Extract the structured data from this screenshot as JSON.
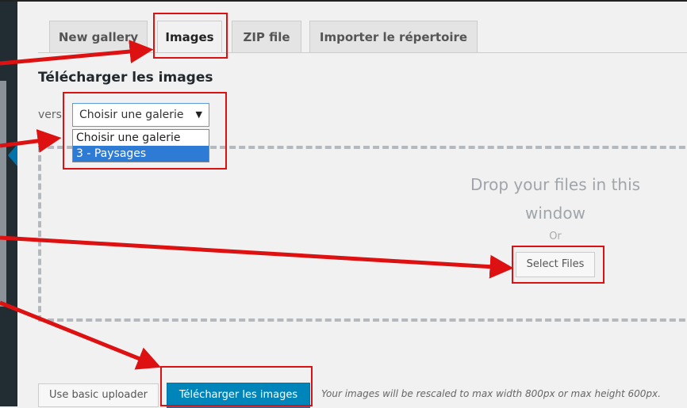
{
  "tabs": [
    {
      "label": "New gallery",
      "active": false
    },
    {
      "label": "Images",
      "active": true
    },
    {
      "label": "ZIP file",
      "active": false
    },
    {
      "label": "Importer le répertoire",
      "active": false
    }
  ],
  "section": {
    "heading": "Télécharger les images"
  },
  "gallery_select": {
    "label": "vers",
    "value": "Choisir une galerie",
    "options": [
      "Choisir une galerie",
      "3 - Paysages"
    ],
    "highlighted_option": "3 - Paysages"
  },
  "dropzone": {
    "message_line1": "Drop your files in this",
    "message_line2": "window",
    "or_text": "Or",
    "select_files_label": "Select Files"
  },
  "footer": {
    "basic_uploader_label": "Use basic uploader",
    "upload_label": "Télécharger les images",
    "note": "Your images will be rescaled to max width 800px or max height 600px."
  },
  "colors": {
    "annotation": "#dd1111",
    "primary_button": "#0085ba",
    "selected_option": "#2e7bd6"
  }
}
